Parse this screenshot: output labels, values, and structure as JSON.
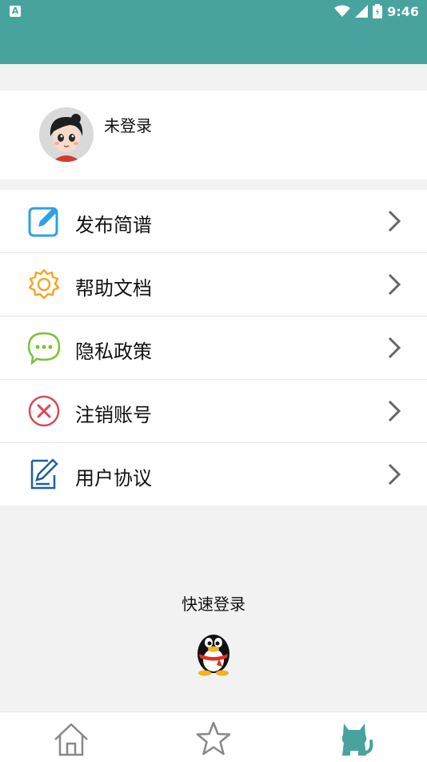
{
  "status_bar": {
    "notification_icon": "A",
    "wifi_icon": "wifi-icon",
    "signal_icon": "signal-icon",
    "battery_icon": "battery-icon",
    "time": "9:46"
  },
  "profile": {
    "avatar_icon": "cartoon-avatar",
    "username": "未登录"
  },
  "menu": {
    "items": [
      {
        "label": "发布简谱",
        "icon": "edit-icon",
        "color": "#2f9fe8"
      },
      {
        "label": "帮助文档",
        "icon": "gear-icon",
        "color": "#f5a623"
      },
      {
        "label": "隐私政策",
        "icon": "chat-bubble-icon",
        "color": "#7cc23a"
      },
      {
        "label": "注销账号",
        "icon": "close-circle-icon",
        "color": "#d94a5a"
      },
      {
        "label": "用户协议",
        "icon": "document-edit-icon",
        "color": "#1f5fa6"
      }
    ]
  },
  "quick_login": {
    "title": "快速登录",
    "icon": "qq-penguin-icon"
  },
  "tab_bar": {
    "tabs": [
      {
        "icon": "home-icon",
        "active": false
      },
      {
        "icon": "star-icon",
        "active": false
      },
      {
        "icon": "cat-icon",
        "active": true
      }
    ],
    "active_color": "#48a39f"
  },
  "colors": {
    "accent": "#48a39f",
    "background": "#f2f2f2"
  }
}
